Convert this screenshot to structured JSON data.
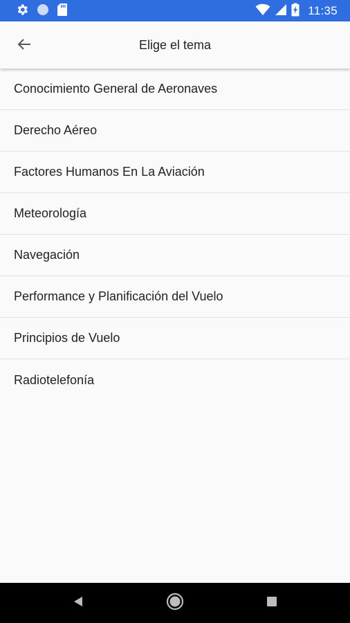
{
  "status_bar": {
    "time": "11:35",
    "background_color": "#2f6ee0",
    "left_icons": [
      "gear-icon",
      "circle-icon",
      "sd-card-icon"
    ],
    "right_icons": [
      "wifi-icon",
      "signal-icon",
      "battery-charging-icon"
    ]
  },
  "toolbar": {
    "title": "Elige el tema",
    "back_icon": "arrow-left-icon"
  },
  "topics": [
    {
      "label": "Conocimiento General de Aeronaves"
    },
    {
      "label": "Derecho Aéreo"
    },
    {
      "label": "Factores Humanos En La Aviación"
    },
    {
      "label": "Meteorología"
    },
    {
      "label": "Navegación"
    },
    {
      "label": "Performance y Planificación del Vuelo"
    },
    {
      "label": "Principios de Vuelo"
    },
    {
      "label": "Radiotelefonía"
    }
  ],
  "nav_bar": {
    "buttons": [
      "back-triangle-icon",
      "home-circle-icon",
      "recents-square-icon"
    ]
  }
}
